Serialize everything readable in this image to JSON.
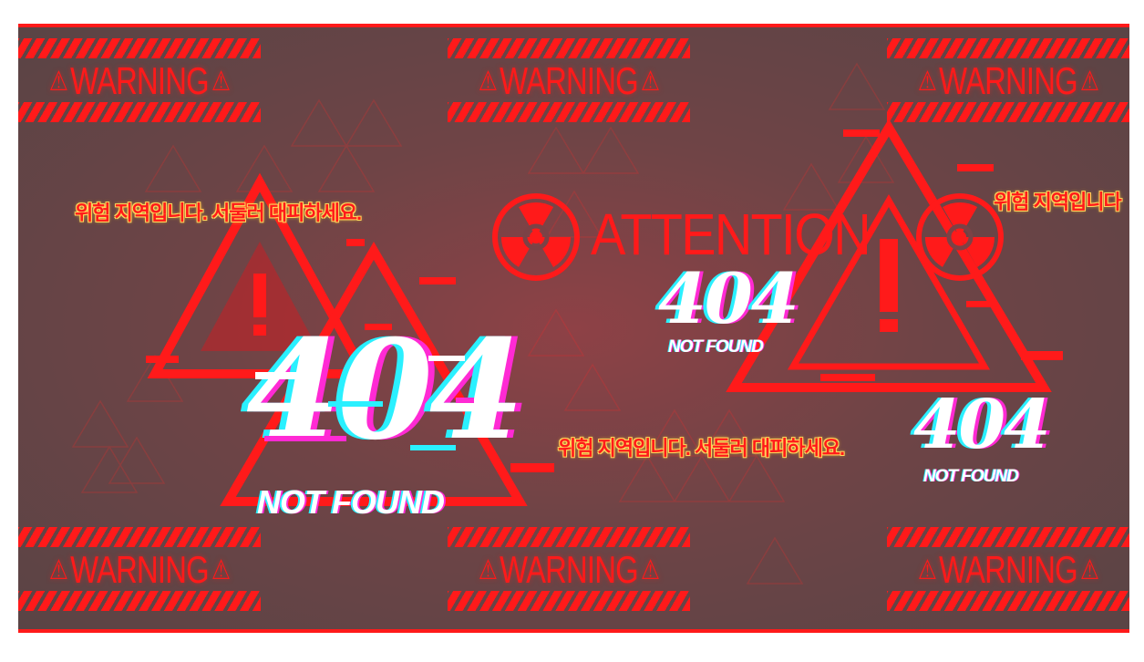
{
  "banners": {
    "label": "WARNING",
    "icon": "warning-triangle-icon",
    "color": "#ff1a1a"
  },
  "messages": {
    "korean_warning": "위험 지역입니다. 서둘러 대피하세요.",
    "korean_warning_cut": "위험 지역입니다"
  },
  "errors": {
    "code": "404",
    "label": "NOT FOUND"
  },
  "attention": {
    "label": "ATTENTION",
    "icon": "radiation-icon"
  },
  "colors": {
    "accent": "#ff1a1a",
    "glitch_cyan": "#2af0ff",
    "glitch_magenta": "#ff2ad4",
    "text_outline": "#ffd65c"
  }
}
